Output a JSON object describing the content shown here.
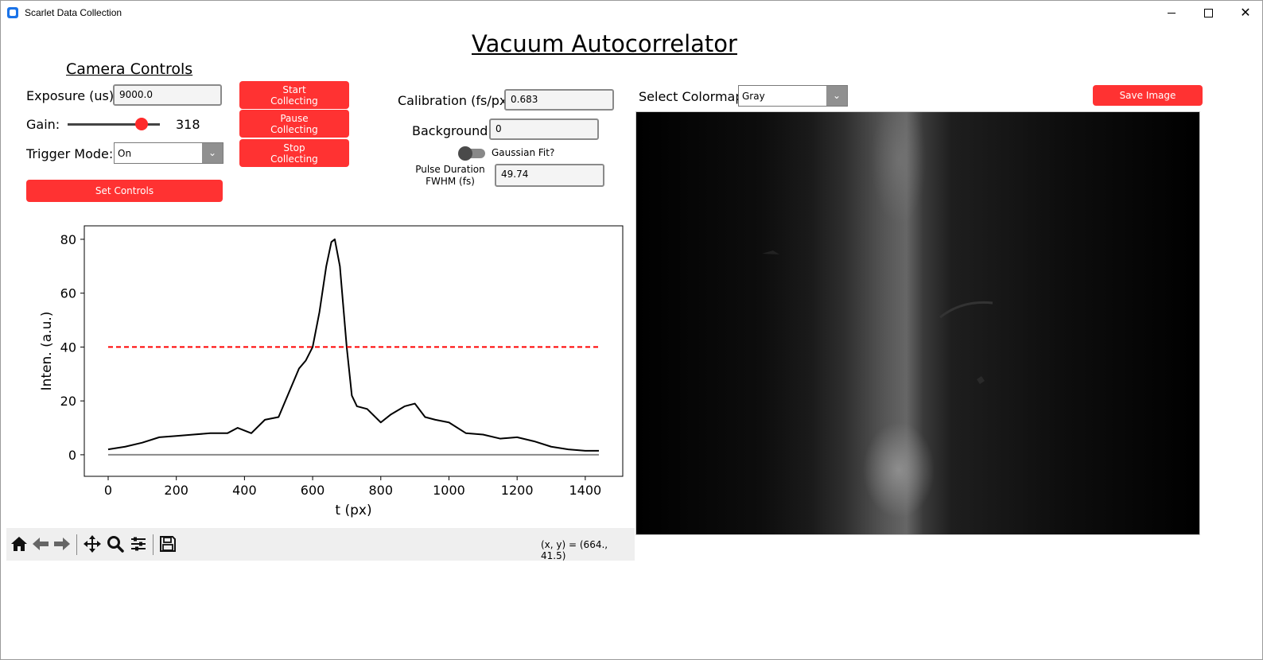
{
  "window": {
    "title": "Scarlet Data Collection",
    "close_glyph": "✕"
  },
  "header": {
    "title": "Vacuum Autocorrelator"
  },
  "camera_controls": {
    "title": "Camera Controls",
    "exposure_label": "Exposure (us):",
    "exposure_value": "9000.0",
    "gain_label": "Gain:",
    "gain_value": "318",
    "gain_slider_fraction": 0.8,
    "trigger_label": "Trigger Mode:",
    "trigger_value": "On",
    "set_controls": "Set Controls"
  },
  "collect_buttons": {
    "start_line1": "Start",
    "start_line2": "Collecting",
    "pause_line1": "Pause",
    "pause_line2": "Collecting",
    "stop_line1": "Stop",
    "stop_line2": "Collecting"
  },
  "analysis": {
    "calibration_label": "Calibration (fs/px):",
    "calibration_value": "0.683",
    "background_label": "Background:",
    "background_value": "0",
    "gaussian_label": "Gaussian Fit?",
    "gaussian_on": false,
    "pulse_label_line1": "Pulse Duration",
    "pulse_label_line2": "FWHM (fs)",
    "pulse_value": "49.74"
  },
  "image_panel": {
    "colormap_label": "Select Colormap",
    "colormap_value": "Gray",
    "save_image": "Save Image"
  },
  "toolbar": {
    "icons": [
      "home-icon",
      "back-arrow-icon",
      "forward-arrow-icon",
      "pan-icon",
      "zoom-icon",
      "configure-subplots-icon",
      "save-icon"
    ],
    "coords": "(x, y) = (664., 41.5)"
  },
  "colors": {
    "accent": "#ff3232",
    "threshold_line": "#ff0000",
    "trace": "#000000"
  },
  "chart_data": {
    "type": "line",
    "title": "",
    "xlabel": "t (px)",
    "ylabel": "Inten. (a.u.)",
    "xlim": [
      -70,
      1510
    ],
    "ylim": [
      -8,
      85
    ],
    "xticks": [
      0,
      200,
      400,
      600,
      800,
      1000,
      1200,
      1400
    ],
    "yticks": [
      0,
      20,
      40,
      60,
      80
    ],
    "grid": false,
    "series": [
      {
        "x": [
          0,
          50,
          100,
          150,
          200,
          250,
          300,
          350,
          380,
          400,
          420,
          460,
          500,
          530,
          560,
          580,
          600,
          620,
          640,
          655,
          665,
          680,
          700,
          715,
          730,
          760,
          800,
          830,
          870,
          900,
          930,
          960,
          1000,
          1050,
          1100,
          1150,
          1200,
          1250,
          1300,
          1350,
          1400,
          1440
        ],
        "y": [
          2,
          3,
          4.5,
          6.5,
          7,
          7.5,
          8,
          8,
          10,
          9,
          8,
          13,
          14,
          23,
          32,
          35,
          40,
          53,
          70,
          79,
          80,
          70,
          40,
          22,
          18,
          17,
          12,
          15,
          18,
          19,
          14,
          13,
          12,
          8,
          7.5,
          6,
          6.5,
          5,
          3,
          2,
          1.5,
          1.5
        ]
      },
      {
        "x": [
          0,
          1440
        ],
        "y": [
          40,
          40
        ]
      },
      {
        "x": [
          0,
          1440
        ],
        "y": [
          0,
          0
        ]
      }
    ]
  }
}
